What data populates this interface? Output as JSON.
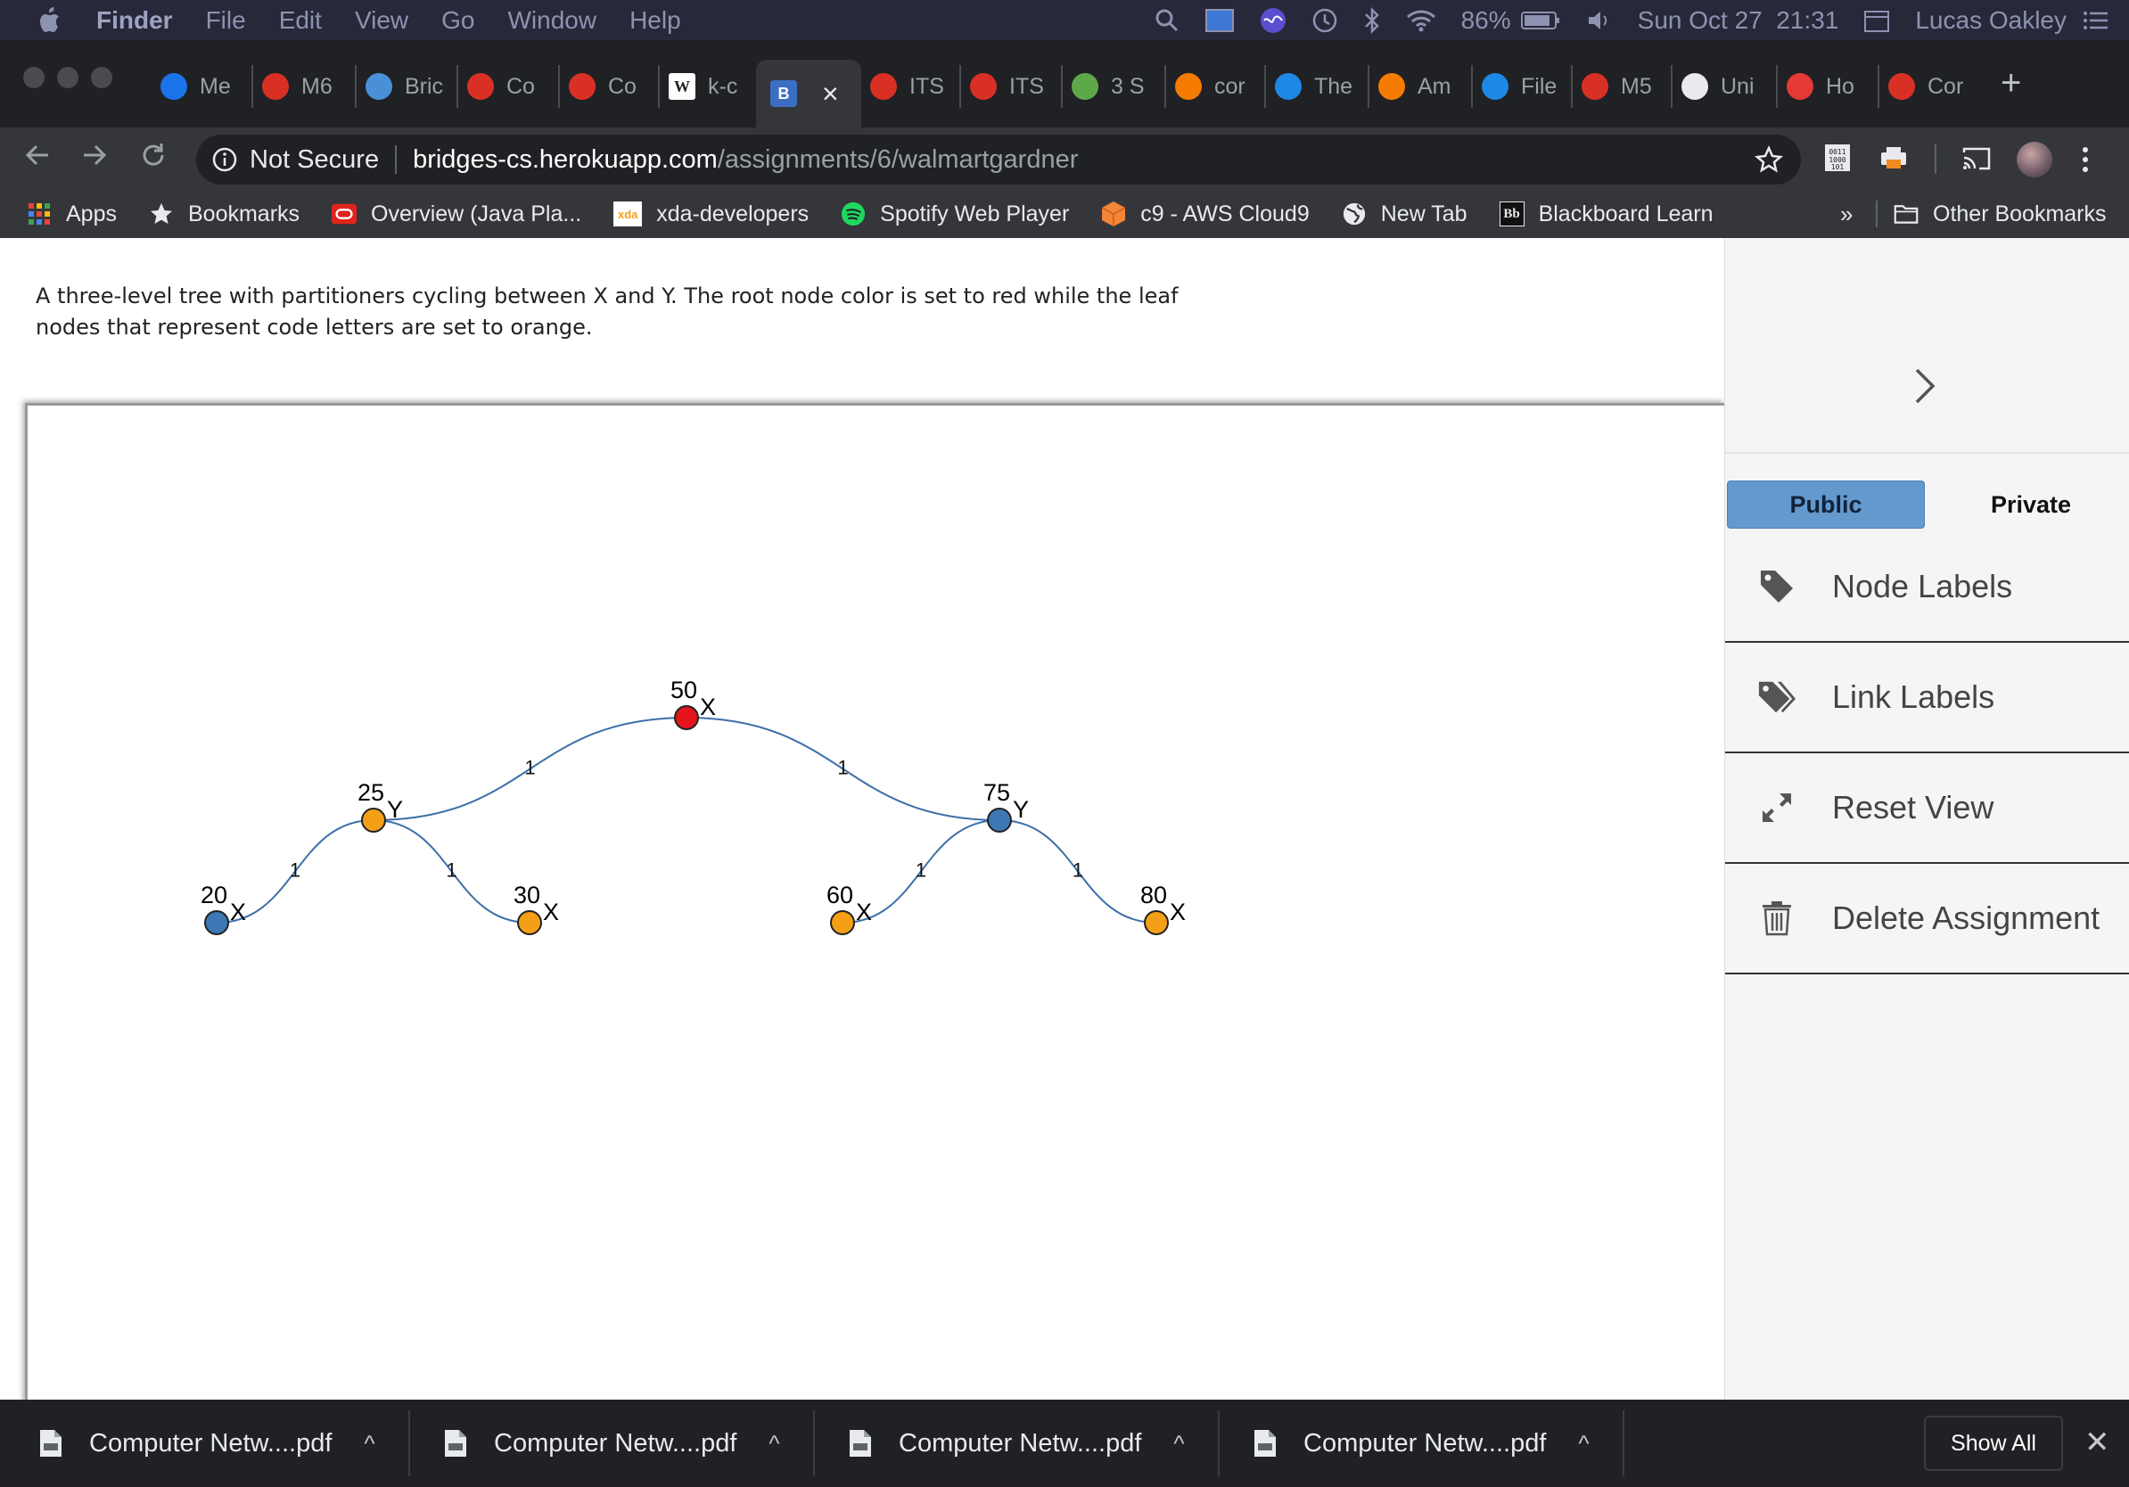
{
  "menubar": {
    "app": "Finder",
    "items": [
      "File",
      "Edit",
      "View",
      "Go",
      "Window",
      "Help"
    ],
    "battery": "86%",
    "datetime": "Sun Oct 27  21:31",
    "user": "Lucas Oakley"
  },
  "tabs": [
    {
      "label": "Me",
      "color": "#1a73e8"
    },
    {
      "label": "M6",
      "color": "#d93025"
    },
    {
      "label": "Bric",
      "color": "#4a90d9"
    },
    {
      "label": "Co",
      "color": "#d93025"
    },
    {
      "label": "Co",
      "color": "#d93025"
    },
    {
      "label": "k-c",
      "color": "#ffffff"
    },
    {
      "label": "",
      "color": "#3b6fc4",
      "active": true
    },
    {
      "label": "ITS",
      "color": "#d93025"
    },
    {
      "label": "ITS",
      "color": "#d93025"
    },
    {
      "label": "3 S",
      "color": "#5fa84a"
    },
    {
      "label": "cor",
      "color": "#f57c00"
    },
    {
      "label": "The",
      "color": "#1e88e5"
    },
    {
      "label": "Am",
      "color": "#f57c00"
    },
    {
      "label": "File",
      "color": "#1e88e5"
    },
    {
      "label": "M5",
      "color": "#d93025"
    },
    {
      "label": "Uni",
      "color": "#e8eaed"
    },
    {
      "label": "Ho",
      "color": "#e53935"
    },
    {
      "label": "Cor",
      "color": "#d93025"
    }
  ],
  "active_tab_icon_letter": "B",
  "close_glyph": "×",
  "new_tab_glyph": "+",
  "address": {
    "security": "Not Secure",
    "host": "bridges-cs.herokuapp.com",
    "path": "/assignments/6/walmartgardner"
  },
  "bookmarks": [
    {
      "label": "Apps",
      "icon": "apps-grid-icon"
    },
    {
      "label": "Bookmarks",
      "icon": "star-icon"
    },
    {
      "label": "Overview (Java Pla...",
      "icon": "oracle-icon"
    },
    {
      "label": "xda-developers",
      "icon": "xda-icon"
    },
    {
      "label": "Spotify Web Player",
      "icon": "spotify-icon"
    },
    {
      "label": "c9 - AWS Cloud9",
      "icon": "cloud9-icon"
    },
    {
      "label": "New Tab",
      "icon": "globe-icon"
    },
    {
      "label": "Blackboard Learn",
      "icon": "blackboard-icon"
    }
  ],
  "bookmarks_more": "»",
  "other_bookmarks": "Other Bookmarks",
  "description": "A three-level tree with partitioners cycling between X and Y. The root node color is set to red while the leaf nodes that represent code letters are set to orange.",
  "tree": {
    "nodes": [
      {
        "id": "50",
        "label": "50",
        "part": "X",
        "color": "#e3141a"
      },
      {
        "id": "25",
        "label": "25",
        "part": "Y",
        "color": "#f59f16"
      },
      {
        "id": "75",
        "label": "75",
        "part": "Y",
        "color": "#3d78b4"
      },
      {
        "id": "20",
        "label": "20",
        "part": "X",
        "color": "#3d78b4"
      },
      {
        "id": "30",
        "label": "30",
        "part": "X",
        "color": "#f59f16"
      },
      {
        "id": "60",
        "label": "60",
        "part": "X",
        "color": "#f59f16"
      },
      {
        "id": "80",
        "label": "80",
        "part": "X",
        "color": "#f59f16"
      }
    ],
    "links": [
      {
        "from": "50",
        "to": "25",
        "label": "1"
      },
      {
        "from": "50",
        "to": "75",
        "label": "1"
      },
      {
        "from": "25",
        "to": "20",
        "label": "1"
      },
      {
        "from": "25",
        "to": "30",
        "label": "1"
      },
      {
        "from": "75",
        "to": "60",
        "label": "1"
      },
      {
        "from": "75",
        "to": "80",
        "label": "1"
      }
    ],
    "link_color": "#3d6fa8"
  },
  "sidebar": {
    "toggle": "›",
    "public": "Public",
    "private": "Private",
    "items": [
      {
        "label": "Node Labels",
        "icon": "tag-icon"
      },
      {
        "label": "Link Labels",
        "icon": "tags-icon"
      },
      {
        "label": "Reset View",
        "icon": "expand-arrows-icon"
      },
      {
        "label": "Delete Assignment",
        "icon": "trash-icon"
      }
    ]
  },
  "downloads": {
    "files": [
      "Computer Netw....pdf",
      "Computer Netw....pdf",
      "Computer Netw....pdf",
      "Computer Netw....pdf"
    ],
    "chevron": "^",
    "show_all": "Show All",
    "close": "✕"
  }
}
